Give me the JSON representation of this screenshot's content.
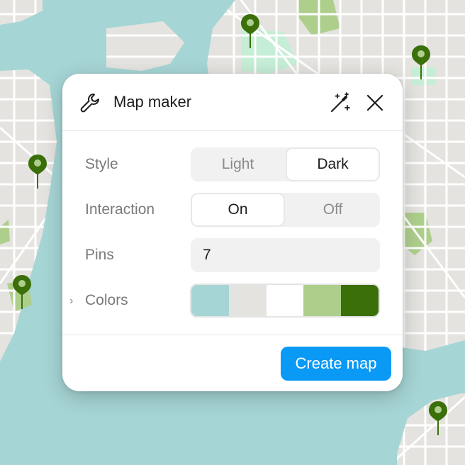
{
  "panel": {
    "title": "Map maker",
    "icons": {
      "header": "wrench-icon",
      "magic": "magic-wand-icon",
      "close": "close-icon"
    }
  },
  "style": {
    "label": "Style",
    "options": [
      "Light",
      "Dark"
    ],
    "selected": "Dark"
  },
  "interaction": {
    "label": "Interaction",
    "options": [
      "On",
      "Off"
    ],
    "selected": "On"
  },
  "pins": {
    "label": "Pins",
    "value": "7"
  },
  "colors": {
    "label": "Colors",
    "expander_icon": "chevron-right-icon",
    "swatches": [
      "#a6d5d5",
      "#e4e3df",
      "#ffffff",
      "#aecf8c",
      "#3a6f0a"
    ]
  },
  "actions": {
    "create_label": "Create map"
  },
  "theme": {
    "accent": "#0a99f5",
    "water": "#a6d5d5",
    "land": "#e4e3df",
    "park": "#aecf8c",
    "pin": "#3a6f0a"
  }
}
